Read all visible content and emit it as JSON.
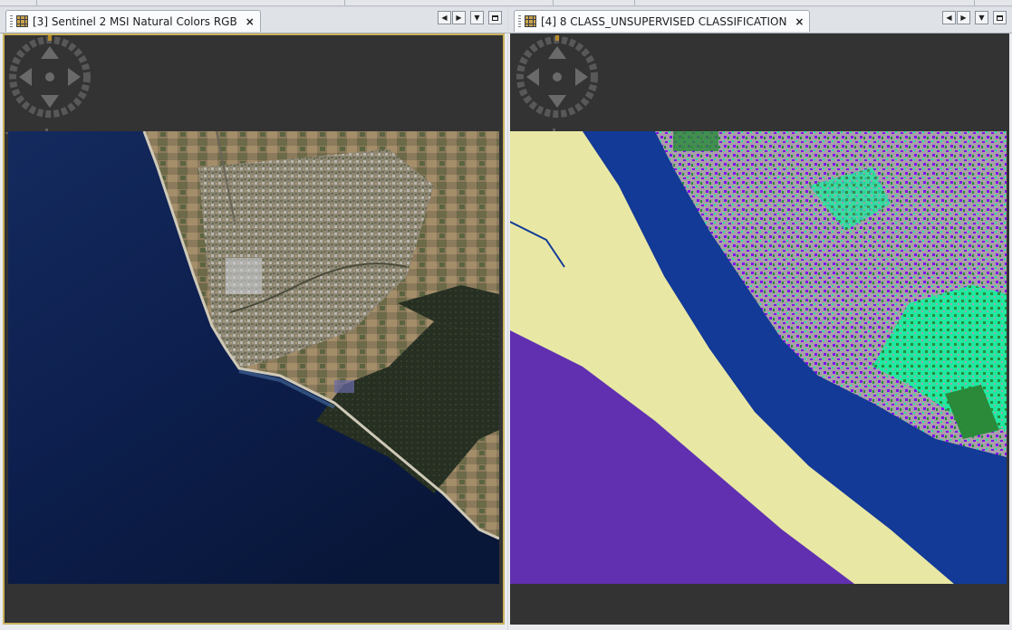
{
  "views": [
    {
      "tab_label": "[3] Sentinel 2 MSI Natural Colors RGB",
      "close_label": "×",
      "active": true,
      "image_kind": "natural-color satellite image"
    },
    {
      "tab_label": "[4] 8 CLASS_UNSUPERVISED CLASSIFICATION",
      "close_label": "×",
      "active": false,
      "image_kind": "unsupervised classification map"
    }
  ],
  "controls": {
    "prev": "◀",
    "next": "▶",
    "menu": "▼"
  },
  "colors": {
    "viewport_bg": "#333333",
    "active_border": "#c9b25d",
    "sea_dark": "#0a1a3c",
    "sea_mid": "#17306a",
    "land_natural": "#8a8068",
    "forest": "#2a3524",
    "class_purple": "#6030b0",
    "class_beige": "#e8e8a4",
    "class_blue": "#123a96",
    "class_grey": "#a8a0a8",
    "class_violet": "#8010f0",
    "class_teal": "#20e8a0",
    "class_green": "#2a8a3a"
  }
}
